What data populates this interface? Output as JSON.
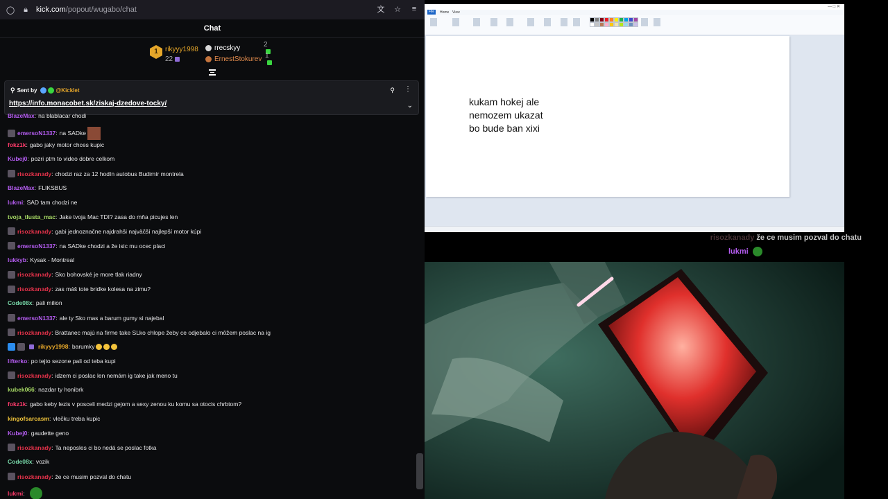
{
  "browser": {
    "url_host": "kick.com",
    "url_path": "/popout/wugabo/chat"
  },
  "chat": {
    "title": "Chat",
    "leaderboard": {
      "first": {
        "rank": "1",
        "name": "rikyyy1998",
        "count": "22"
      },
      "second": {
        "name": "rrecskyy",
        "count": "2"
      },
      "third": {
        "name": "ErnestStokurev",
        "count": "1"
      }
    },
    "pinned": {
      "sent_by_label": "Sent by",
      "user": "@Kicklet",
      "link": "https://info.monacobet.sk/ziskaj-dzedove-tocky/"
    },
    "messages": [
      {
        "user": "BlazeMax",
        "color": "#b45cf0",
        "text": "na blablacar chodi",
        "avatar": false
      },
      {
        "user": "emersoN1337",
        "color": "#b45cf0",
        "text": "na SADke",
        "avatar": true,
        "photo": true
      },
      {
        "user": "fokz1k",
        "color": "#ff3b6b",
        "text": "gabo jaky motor chces kupic",
        "avatar": false
      },
      {
        "user": "Kubej0",
        "color": "#b45cf0",
        "text": "pozri ptm to video dobre celkom",
        "avatar": false
      },
      {
        "user": "risozkanady",
        "color": "#e3324a",
        "text": "chodzi raz za 12 hodín autobus Budimír montrela",
        "avatar": true
      },
      {
        "user": "BlazeMax",
        "color": "#b45cf0",
        "text": "FLIKSBUS",
        "avatar": false
      },
      {
        "user": "lukmi",
        "color": "#b45cf0",
        "text": "SAD tam chodzi ne",
        "avatar": false
      },
      {
        "user": "tvoja_tlusta_mac",
        "color": "#a6d864",
        "text": "Jake tvoja Mac TDI? zasa do mňa picujes len",
        "avatar": false
      },
      {
        "user": "risozkanady",
        "color": "#e3324a",
        "text": "gabi jednoznačne najdrahši najväčší najlepší motor kúpi",
        "avatar": true
      },
      {
        "user": "emersoN1337",
        "color": "#b45cf0",
        "text": "na SADke chodzi a že isic mu ocec placi",
        "avatar": true
      },
      {
        "user": "lukkyb",
        "color": "#b45cf0",
        "text": "Kysak - Montreal",
        "avatar": false
      },
      {
        "user": "risozkanady",
        "color": "#e3324a",
        "text": "Sko bohovské je more tlak riadny",
        "avatar": true
      },
      {
        "user": "risozkanady",
        "color": "#e3324a",
        "text": "zas máš tote bridke kolesa na zimu?",
        "avatar": true
      },
      {
        "user": "Code08x",
        "color": "#77d7a8",
        "text": "pali milion",
        "avatar": false
      },
      {
        "user": "emersoN1337",
        "color": "#b45cf0",
        "text": "ale ty Sko mas a barum gumy si najebal",
        "avatar": true
      },
      {
        "user": "risozkanady",
        "color": "#e3324a",
        "text": "Brattanec majú na firme take SLko chlope žeby ce odjebalo ci môžem poslac na ig",
        "avatar": true
      },
      {
        "user": "rikyyy1998",
        "color": "#e6a72a",
        "text": "barumky",
        "avatar": true,
        "badges": true,
        "emotes": 3
      },
      {
        "user": "lifterko",
        "color": "#b45cf0",
        "text": "po tejto sezone pali od teba kupi",
        "avatar": false
      },
      {
        "user": "risozkanady",
        "color": "#e3324a",
        "text": "idzem ci poslac len nemám ig take jak meno tu",
        "avatar": true
      },
      {
        "user": "kubek066",
        "color": "#a6d864",
        "text": "nazdar ty honibrk",
        "avatar": false
      },
      {
        "user": "fokz1k",
        "color": "#ff3b6b",
        "text": "gabo keby lezis v posceli medzi gejom a sexy zenou ku komu sa otocis chrbtom?",
        "avatar": false
      },
      {
        "user": "kingofsarcasm",
        "color": "#f0c43b",
        "text": "vlečku treba kupic",
        "avatar": false
      },
      {
        "user": "Kubej0",
        "color": "#b45cf0",
        "text": "gaudette geno",
        "avatar": false
      },
      {
        "user": "risozkanady",
        "color": "#e3324a",
        "text": "Ta neposles ci bo nedá se poslac fotka",
        "avatar": true
      },
      {
        "user": "Code08x",
        "color": "#77d7a8",
        "text": "vozik",
        "avatar": false
      },
      {
        "user": "risozkanady",
        "color": "#e3324a",
        "text": "že ce musim pozval do chatu",
        "avatar": true
      },
      {
        "user": "lukmi",
        "color": "#ff3b6b",
        "text": "",
        "avatar": false,
        "big_emote": true
      }
    ]
  },
  "paint": {
    "tab_file": "File",
    "tab_home": "Home",
    "tab_view": "View",
    "text_lines": [
      "kukam hokej ale",
      "nemozem ukazat",
      "bo bude ban xixi"
    ]
  },
  "stream_overlay": {
    "line1_user": "risozkanady",
    "line1_text": "že ce musim pozval do chatu",
    "line2_user": "lukmi"
  }
}
